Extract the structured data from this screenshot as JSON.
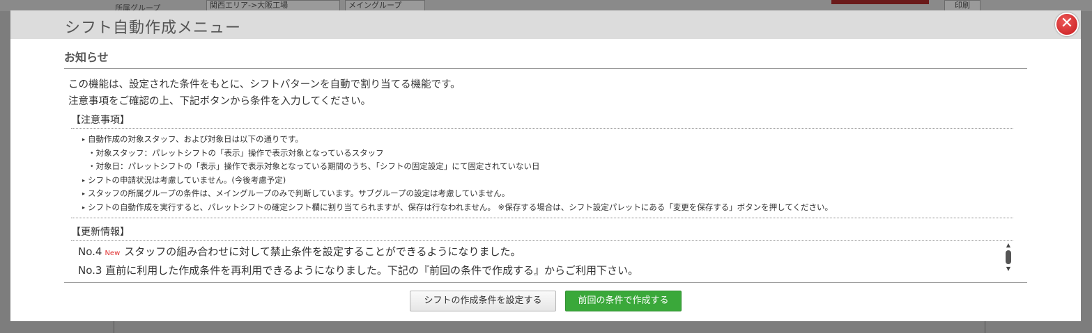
{
  "background": {
    "group_label": "所属グループ",
    "area_select": "関西エリア->大阪工場",
    "group_select": "メイングループ",
    "print_label": "印刷"
  },
  "modal": {
    "title": "シフト自動作成メニュー",
    "close_symbol": "✕"
  },
  "notice": {
    "title": "お知らせ",
    "intro": [
      "この機能は、設定された条件をもとに、シフトパターンを自動で割り当てる機能です。",
      "注意事項をご確認の上、下記ボタンから条件を入力してください。"
    ],
    "cautions_heading": "【注意事項】",
    "cautions": [
      "自動作成の対象スタッフ、および対象日は以下の通りです。",
      "・対象スタッフ：パレットシフトの「表示」操作で表示対象となっているスタッフ",
      "・対象日：パレットシフトの「表示」操作で表示対象となっている期間のうち、「シフトの固定設定」にて固定されていない日",
      "シフトの申請状況は考慮していません。(今後考慮予定)",
      "スタッフの所属グループの条件は、メイングループのみで判断しています。サブグループの設定は考慮していません。",
      "シフトの自動作成を実行すると、パレットシフトの確定シフト欄に割り当てられますが、保存は行なわれません。 ※保存する場合は、シフト設定パレットにある「変更を保存する」ボタンを押してください。"
    ],
    "updates_heading": "【更新情報】",
    "updates": [
      {
        "no": "No.4",
        "badge": "New",
        "text": "スタッフの組み合わせに対して禁止条件を設定することができるようになりました。"
      },
      {
        "no": "No.3",
        "badge": "",
        "text": "直前に利用した作成条件を再利用できるようになりました。下記の『前回の条件で作成する』からご利用下さい。"
      }
    ]
  },
  "buttons": {
    "set_conditions": "シフトの作成条件を設定する",
    "create_previous": "前回の条件で作成する"
  },
  "colors": {
    "primary_button": "#3aa83a",
    "close_button": "#c8191c",
    "new_badge": "#e03030"
  }
}
